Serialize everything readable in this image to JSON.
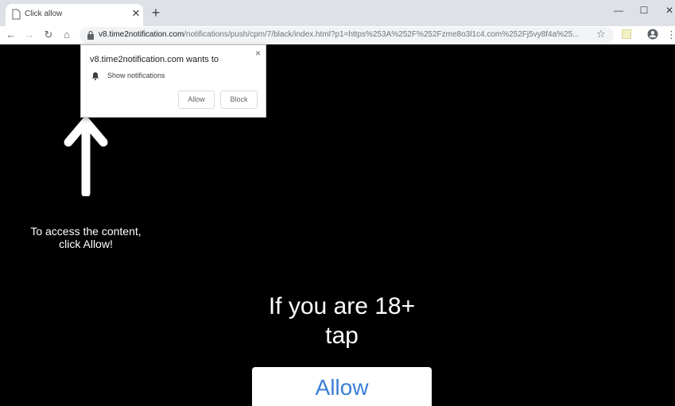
{
  "tab": {
    "title": "Click allow"
  },
  "toolbar": {
    "url_host": "v8.time2notification.com",
    "url_path": "/notifications/push/cpm/7/black/index.html?p1=https%253A%252F%252Fzme8o3l1c4.com%252Fj5vy8f4a%25..."
  },
  "popup": {
    "title": "v8.time2notification.com wants to",
    "permission": "Show notifications",
    "allow_label": "Allow",
    "block_label": "Block",
    "close_glyph": "×"
  },
  "page": {
    "access_line1": "To access the content,",
    "access_line2": "click Allow!",
    "cta_line1": "If you are 18+",
    "cta_line2": "tap",
    "allow_button": "Allow"
  },
  "colors": {
    "page_bg": "#000000",
    "allow_text": "#3b7fd5"
  },
  "icons": [
    "page-favicon-icon",
    "close-icon",
    "plus-icon",
    "back-icon",
    "forward-icon",
    "reload-icon",
    "home-icon",
    "lock-icon",
    "star-icon",
    "extension-icon",
    "profile-icon",
    "menu-icon",
    "bell-icon",
    "up-arrow-icon"
  ]
}
